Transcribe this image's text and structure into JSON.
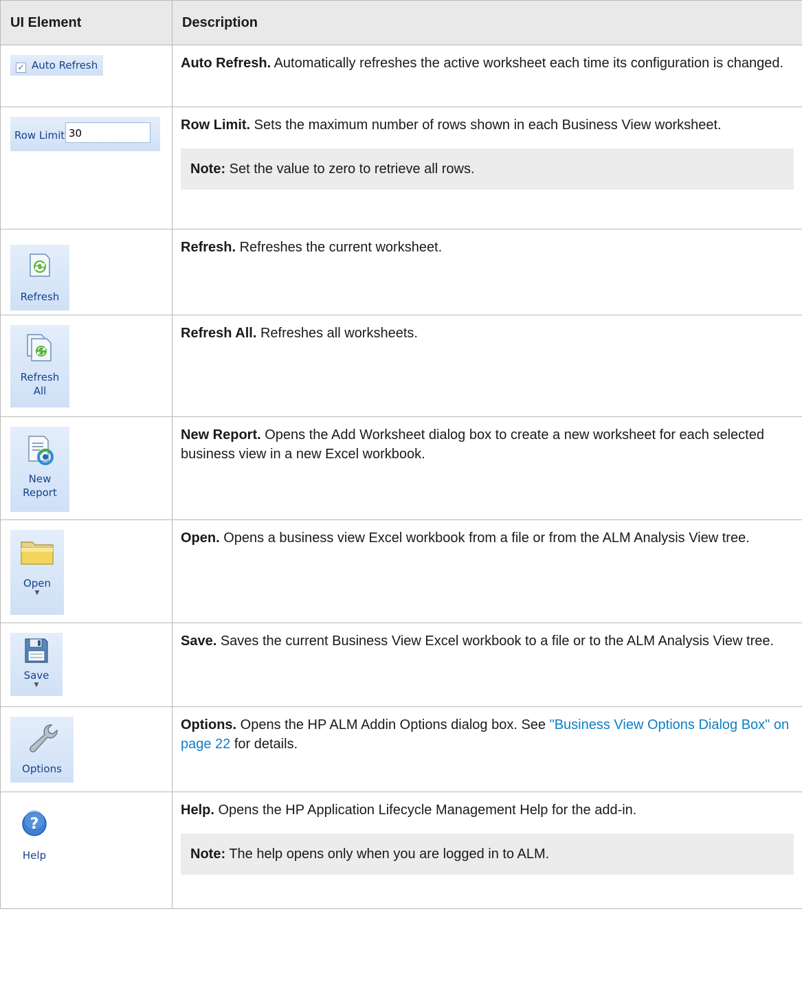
{
  "table": {
    "header_ui": "UI Element",
    "header_desc": "Description"
  },
  "rows": {
    "auto_refresh": {
      "ui_label": "Auto Refresh",
      "title": "Auto Refresh.",
      "text": "Automatically refreshes the active worksheet each time its configuration is changed."
    },
    "row_limit": {
      "ui_label": "Row Limit",
      "ui_value": "30",
      "title": "Row Limit.",
      "text": "Sets the maximum number of rows shown in each Business View worksheet.",
      "note_label": "Note:",
      "note_text": "Set the value to zero to retrieve all rows."
    },
    "refresh": {
      "ui_label": "Refresh",
      "title": "Refresh.",
      "text": "Refreshes the current worksheet."
    },
    "refresh_all": {
      "ui_label_1": "Refresh",
      "ui_label_2": "All",
      "title": "Refresh All.",
      "text": "Refreshes all worksheets."
    },
    "new_report": {
      "ui_label_1": "New",
      "ui_label_2": "Report",
      "title": "New Report.",
      "text": "Opens the Add Worksheet dialog box to create a new worksheet for each selected business view in a new Excel workbook."
    },
    "open": {
      "ui_label": "Open",
      "title": "Open.",
      "text": "Opens a business view Excel workbook from a file or from the ALM Analysis View tree."
    },
    "save": {
      "ui_label": "Save",
      "title": "Save.",
      "text": "Saves the current Business View Excel workbook to a file or to the ALM Analysis View tree."
    },
    "options": {
      "ui_label": "Options",
      "title": "Options.",
      "text_before": "Opens the HP ALM Addin Options dialog box. See",
      "link": "\"Business View Options Dialog Box\" on page 22",
      "text_after": "for details."
    },
    "help": {
      "ui_label": "Help",
      "title": "Help.",
      "text": "Opens the HP Application Lifecycle Management Help for the add-in.",
      "note_label": "Note:",
      "note_text": "The help opens only when you are logged in to ALM."
    }
  },
  "colors": {
    "header_bg": "#e9e9e9",
    "note_bg": "#ececec",
    "link": "#0f7ec2",
    "ribbon_text": "#15428b"
  }
}
